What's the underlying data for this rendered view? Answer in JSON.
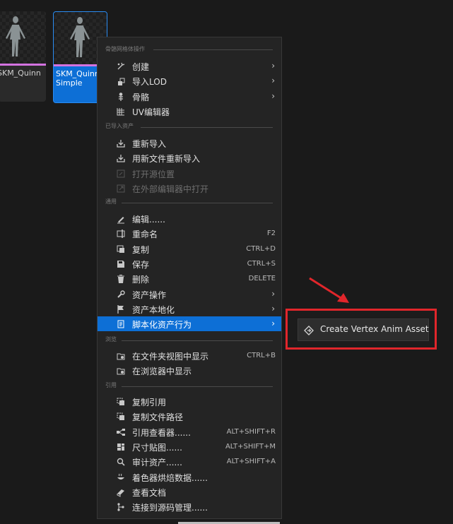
{
  "assets": [
    {
      "label": "SKM_Quinn",
      "selected": false
    },
    {
      "label": "SKM_Quinn\nSimple",
      "selected": true
    }
  ],
  "menu": {
    "sections": [
      {
        "title": "骨骼网格体操作",
        "items": [
          {
            "icon": "create-icon",
            "label": "创建",
            "shortcut": "",
            "submenu": true,
            "disabled": false
          },
          {
            "icon": "lod-icon",
            "label": "导入LOD",
            "shortcut": "",
            "submenu": true,
            "disabled": false
          },
          {
            "icon": "skeleton-icon",
            "label": "骨骼",
            "shortcut": "",
            "submenu": true,
            "disabled": false
          },
          {
            "icon": "uv-icon",
            "label": "UV编辑器",
            "shortcut": "",
            "submenu": false,
            "disabled": false
          }
        ]
      },
      {
        "title": "已导入资产",
        "items": [
          {
            "icon": "reimport-icon",
            "label": "重新导入",
            "shortcut": "",
            "submenu": false,
            "disabled": false
          },
          {
            "icon": "reimport-file-icon",
            "label": "用新文件重新导入",
            "shortcut": "",
            "submenu": false,
            "disabled": false
          },
          {
            "icon": "open-source-icon",
            "label": "打开源位置",
            "shortcut": "",
            "submenu": false,
            "disabled": true
          },
          {
            "icon": "external-editor-icon",
            "label": "在外部编辑器中打开",
            "shortcut": "",
            "submenu": false,
            "disabled": true
          }
        ]
      },
      {
        "title": "通用",
        "items": [
          {
            "icon": "edit-icon",
            "label": "编辑......",
            "shortcut": "",
            "submenu": false,
            "disabled": false
          },
          {
            "icon": "rename-icon",
            "label": "重命名",
            "shortcut": "F2",
            "submenu": false,
            "disabled": false
          },
          {
            "icon": "duplicate-icon",
            "label": "复制",
            "shortcut": "CTRL+D",
            "submenu": false,
            "disabled": false
          },
          {
            "icon": "save-icon",
            "label": "保存",
            "shortcut": "CTRL+S",
            "submenu": false,
            "disabled": false
          },
          {
            "icon": "delete-icon",
            "label": "删除",
            "shortcut": "DELETE",
            "submenu": false,
            "disabled": false
          },
          {
            "icon": "wrench-icon",
            "label": "资产操作",
            "shortcut": "",
            "submenu": true,
            "disabled": false
          },
          {
            "icon": "flag-icon",
            "label": "资产本地化",
            "shortcut": "",
            "submenu": true,
            "disabled": false
          },
          {
            "icon": "script-icon",
            "label": "脚本化资产行为",
            "shortcut": "",
            "submenu": true,
            "disabled": false,
            "highlighted": true
          }
        ]
      },
      {
        "title": "浏览",
        "items": [
          {
            "icon": "folder-view-icon",
            "label": "在文件夹视图中显示",
            "shortcut": "CTRL+B",
            "submenu": false,
            "disabled": false
          },
          {
            "icon": "browser-icon",
            "label": "在浏览器中显示",
            "shortcut": "",
            "submenu": false,
            "disabled": false
          }
        ]
      },
      {
        "title": "引用",
        "items": [
          {
            "icon": "copy-ref-icon",
            "label": "复制引用",
            "shortcut": "",
            "submenu": false,
            "disabled": false
          },
          {
            "icon": "copy-path-icon",
            "label": "复制文件路径",
            "shortcut": "",
            "submenu": false,
            "disabled": false
          },
          {
            "icon": "ref-viewer-icon",
            "label": "引用查看器......",
            "shortcut": "ALT+SHIFT+R",
            "submenu": false,
            "disabled": false
          },
          {
            "icon": "size-map-icon",
            "label": "尺寸贴图......",
            "shortcut": "ALT+SHIFT+M",
            "submenu": false,
            "disabled": false
          },
          {
            "icon": "audit-icon",
            "label": "审计资产......",
            "shortcut": "ALT+SHIFT+A",
            "submenu": false,
            "disabled": false
          },
          {
            "icon": "shader-bake-icon",
            "label": "着色器烘焙数据......",
            "shortcut": "",
            "submenu": false,
            "disabled": false
          },
          {
            "icon": "docs-icon",
            "label": "查看文档",
            "shortcut": "",
            "submenu": false,
            "disabled": false
          },
          {
            "icon": "source-control-icon",
            "label": "连接到源码管理......",
            "shortcut": "",
            "submenu": false,
            "disabled": false
          }
        ]
      }
    ]
  },
  "submenu": {
    "icon": "diamond-arrow-icon",
    "label": "Create Vertex Anim Asset"
  },
  "colors": {
    "highlight": "#0d6fd6",
    "annotation": "#e1262b",
    "asset_bar": "#d473e0"
  }
}
